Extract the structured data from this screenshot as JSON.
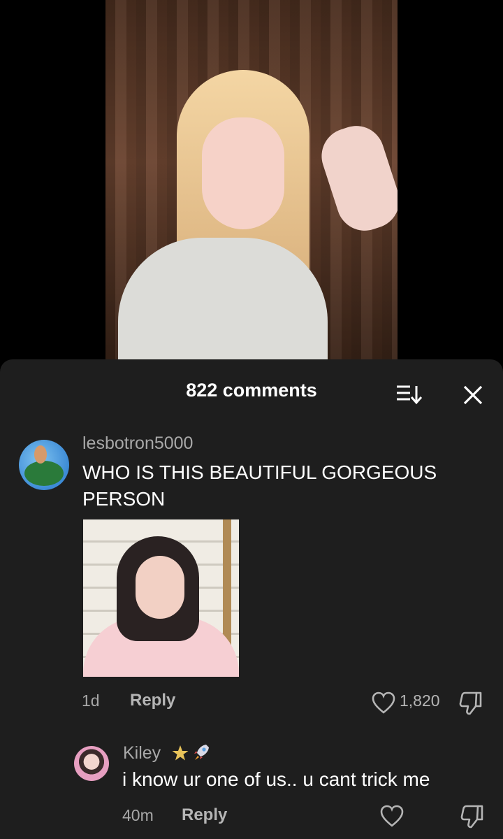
{
  "video": {},
  "comments_sheet": {
    "count_label": "822 comments",
    "sort_icon": "sort-icon",
    "close_icon": "close-icon",
    "comments": [
      {
        "username": "lesbotron5000",
        "text": "WHO IS THIS BEAUTIFUL GORGEOUS PERSON",
        "has_gif": true,
        "time": "1d",
        "reply_label": "Reply",
        "like_count": "1,820"
      },
      {
        "username": "Kiley",
        "badges": [
          "star-icon",
          "rocket-icon"
        ],
        "text": "i know ur one of us.. u cant trick me",
        "time": "40m",
        "reply_label": "Reply"
      }
    ]
  },
  "colors": {
    "sheet_bg": "#1e1e1e",
    "muted_text": "#a8a8a8",
    "reply_text": "#b5b5b5",
    "star": "#e8c35a"
  }
}
